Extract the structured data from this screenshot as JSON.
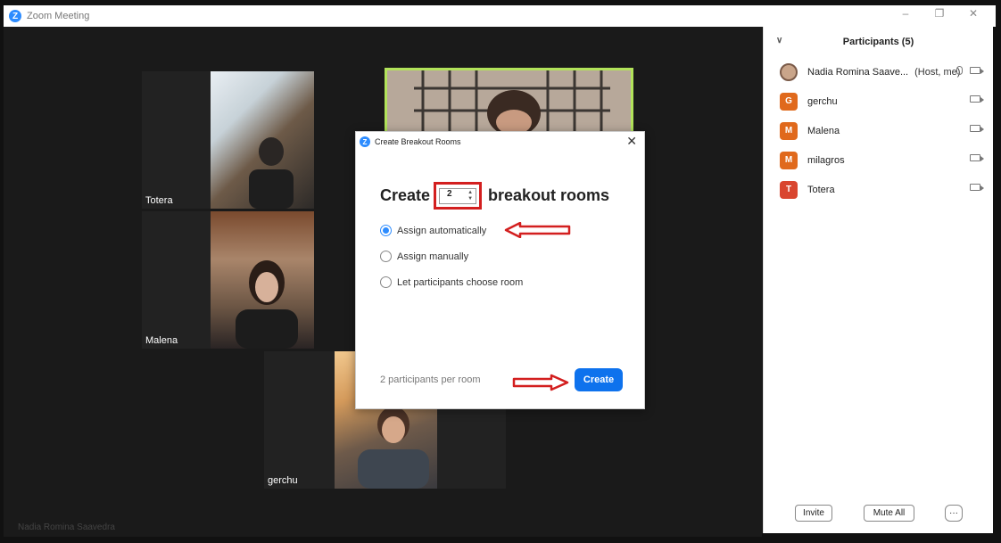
{
  "window": {
    "title": "Zoom Meeting"
  },
  "tiles": [
    {
      "name": "Totera"
    },
    {
      "name": "Malena"
    },
    {
      "name": "gerchu"
    }
  ],
  "bottom_name": "Nadia Romina Saavedra",
  "participants": {
    "title": "Participants (5)",
    "list": [
      {
        "name": "Nadia Romina Saave...",
        "role": "(Host, me)",
        "initial": "",
        "color": "#c9a58a"
      },
      {
        "name": "gerchu",
        "role": "",
        "initial": "G",
        "color": "#e0691c"
      },
      {
        "name": "Malena",
        "role": "",
        "initial": "M",
        "color": "#e0691c"
      },
      {
        "name": "milagros",
        "role": "",
        "initial": "M",
        "color": "#e0691c"
      },
      {
        "name": "Totera",
        "role": "",
        "initial": "T",
        "color": "#d9452f"
      }
    ],
    "invite_label": "Invite",
    "mute_all_label": "Mute All",
    "more_label": "···"
  },
  "dialog": {
    "title": "Create Breakout Rooms",
    "create_prefix": "Create",
    "room_count": "2",
    "create_suffix": "breakout rooms",
    "options": [
      {
        "label": "Assign automatically",
        "checked": true
      },
      {
        "label": "Assign manually",
        "checked": false
      },
      {
        "label": "Let participants choose room",
        "checked": false
      }
    ],
    "per_room": "2 participants per room",
    "create_button": "Create"
  },
  "colors": {
    "accent": "#2d8cff",
    "create_button": "#0e72ed",
    "annotation_red": "#d31f1f",
    "speaker_border": "#b2e35a"
  }
}
